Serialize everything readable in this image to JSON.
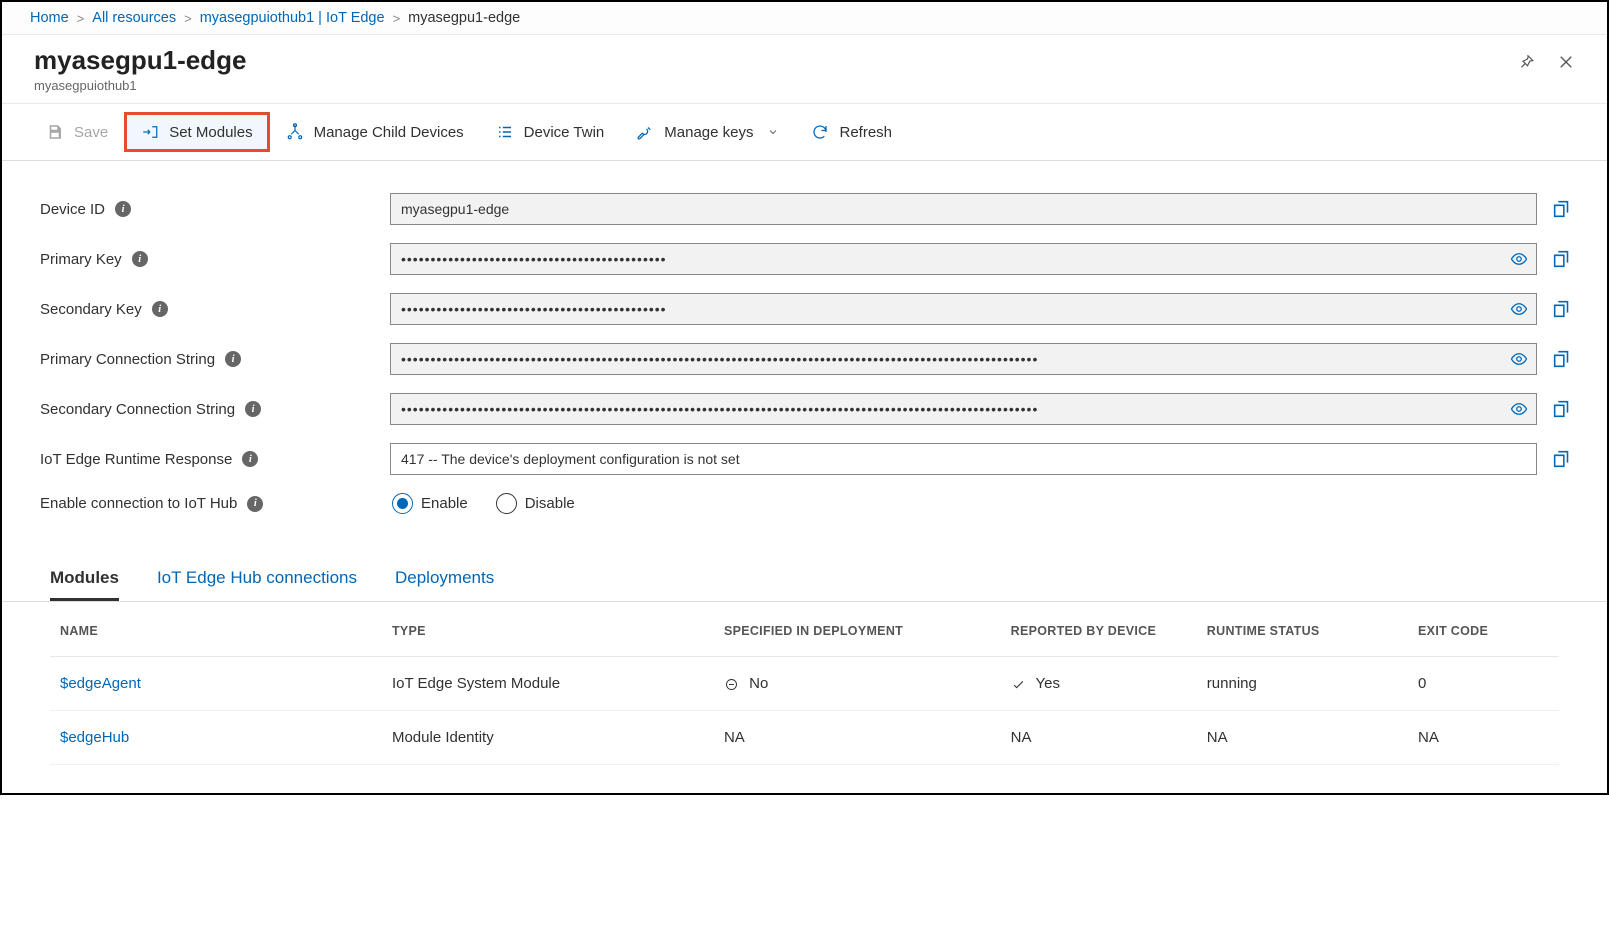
{
  "breadcrumb": {
    "home": "Home",
    "all_resources": "All resources",
    "hub": "myasegpuiothub1 | IoT Edge",
    "current": "myasegpu1-edge"
  },
  "header": {
    "title": "myasegpu1-edge",
    "subtitle": "myasegpuiothub1"
  },
  "commands": {
    "save": "Save",
    "set_modules": "Set Modules",
    "manage_child": "Manage Child Devices",
    "device_twin": "Device Twin",
    "manage_keys": "Manage keys",
    "refresh": "Refresh"
  },
  "form": {
    "device_id_label": "Device ID",
    "device_id_value": "myasegpu1-edge",
    "primary_key_label": "Primary Key",
    "primary_key_mask": "•••••••••••••••••••••••••••••••••••••••••••••",
    "secondary_key_label": "Secondary Key",
    "secondary_key_mask": "•••••••••••••••••••••••••••••••••••••••••••••",
    "primary_cs_label": "Primary Connection String",
    "primary_cs_mask": "••••••••••••••••••••••••••••••••••••••••••••••••••••••••••••••••••••••••••••••••••••••••••••••••••••••••••••",
    "secondary_cs_label": "Secondary Connection String",
    "secondary_cs_mask": "••••••••••••••••••••••••••••••••••••••••••••••••••••••••••••••••••••••••••••••••••••••••••••••••••••••••••••",
    "runtime_label": "IoT Edge Runtime Response",
    "runtime_value": "417 -- The device's deployment configuration is not set",
    "enable_conn_label": "Enable connection to IoT Hub",
    "enable_opt": "Enable",
    "disable_opt": "Disable"
  },
  "tabs": {
    "modules": "Modules",
    "connections": "IoT Edge Hub connections",
    "deployments": "Deployments"
  },
  "table": {
    "headers": {
      "name": "NAME",
      "type": "TYPE",
      "specified": "SPECIFIED IN DEPLOYMENT",
      "reported": "REPORTED BY DEVICE",
      "runtime": "RUNTIME STATUS",
      "exit": "EXIT CODE"
    },
    "rows": [
      {
        "name": "$edgeAgent",
        "type": "IoT Edge System Module",
        "specified": "No",
        "spec_icon": "minus",
        "reported": "Yes",
        "rep_icon": "check",
        "runtime": "running",
        "exit": "0"
      },
      {
        "name": "$edgeHub",
        "type": "Module Identity",
        "specified": "NA",
        "spec_icon": "",
        "reported": "NA",
        "rep_icon": "",
        "runtime": "NA",
        "exit": "NA"
      }
    ]
  }
}
